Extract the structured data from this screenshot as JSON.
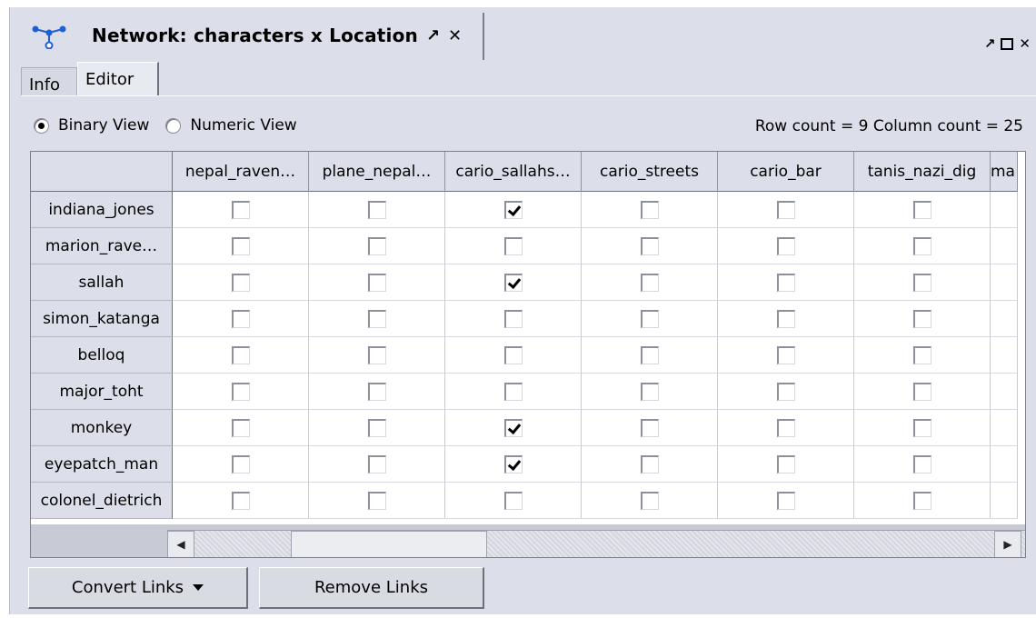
{
  "window": {
    "title": "Network: characters x Location",
    "float_glyph": "↗",
    "close_glyph": "✕"
  },
  "window_controls": {
    "float": "↗",
    "close": "✕"
  },
  "tabs": [
    {
      "label": "Info",
      "selected": false
    },
    {
      "label": "Editor",
      "selected": true
    }
  ],
  "view_options": {
    "binary_label": "Binary View",
    "numeric_label": "Numeric View",
    "selected": "binary"
  },
  "counts_text": "Row count = 9 Column count = 25",
  "grid": {
    "columns": [
      "nepal_raven…",
      "plane_nepal…",
      "cario_sallahs…",
      "cario_streets",
      "cario_bar",
      "tanis_nazi_dig",
      "ma"
    ],
    "rows": [
      {
        "label": "indiana_jones",
        "values": [
          false,
          false,
          true,
          false,
          false,
          false
        ]
      },
      {
        "label": "marion_rave…",
        "values": [
          false,
          false,
          false,
          false,
          false,
          false
        ]
      },
      {
        "label": "sallah",
        "values": [
          false,
          false,
          true,
          false,
          false,
          false
        ]
      },
      {
        "label": "simon_katanga",
        "values": [
          false,
          false,
          false,
          false,
          false,
          false
        ]
      },
      {
        "label": "belloq",
        "values": [
          false,
          false,
          false,
          false,
          false,
          false
        ]
      },
      {
        "label": "major_toht",
        "values": [
          false,
          false,
          false,
          false,
          false,
          false
        ]
      },
      {
        "label": "monkey",
        "values": [
          false,
          false,
          true,
          false,
          false,
          false
        ]
      },
      {
        "label": "eyepatch_man",
        "values": [
          false,
          false,
          true,
          false,
          false,
          false
        ]
      },
      {
        "label": "colonel_dietrich",
        "values": [
          false,
          false,
          false,
          false,
          false,
          false
        ]
      }
    ]
  },
  "buttons": {
    "convert": "Convert Links",
    "remove": "Remove Links"
  },
  "colors": {
    "panel_bg": "#dcdfe9",
    "icon_blue": "#1f5fd6"
  }
}
